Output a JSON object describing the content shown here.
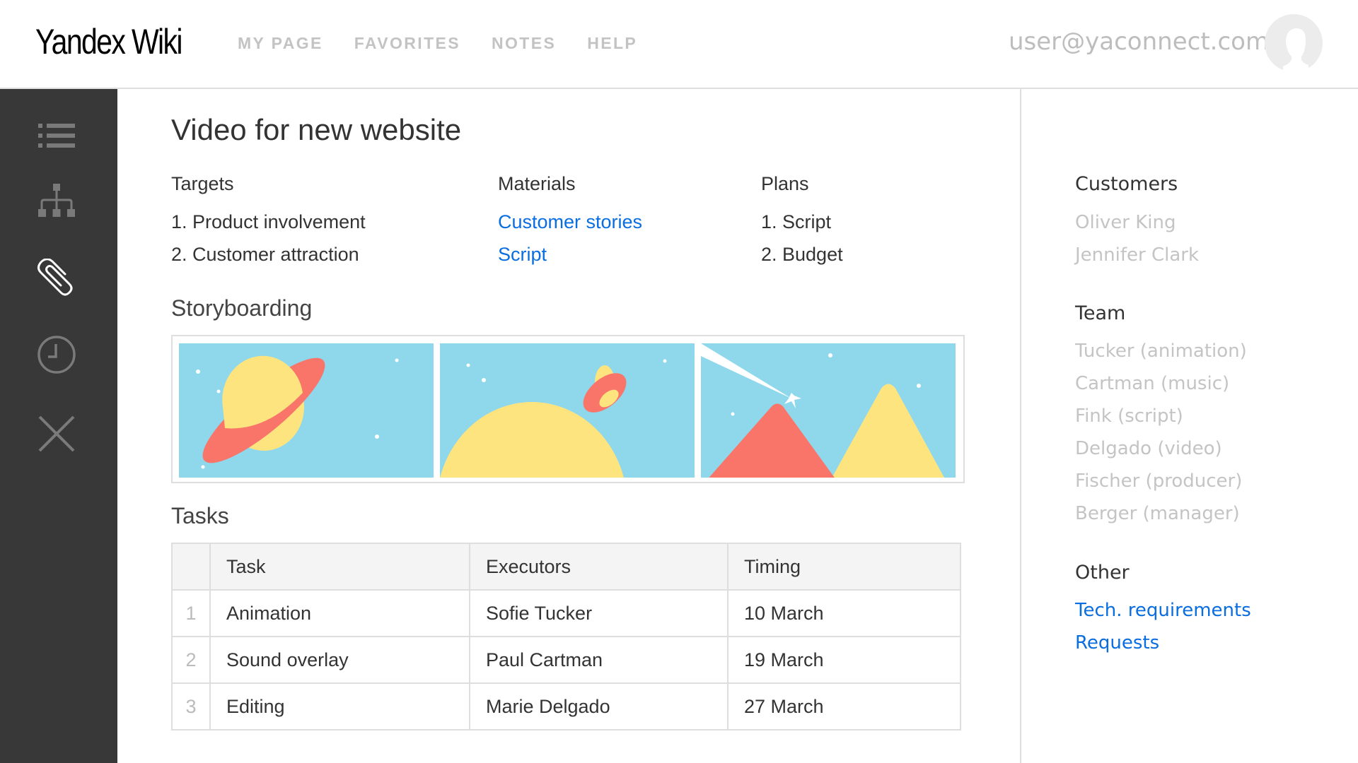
{
  "header": {
    "logo_brand": "Yandex",
    "logo_product": "Wiki",
    "nav": [
      "MY PAGE",
      "FAVORITES",
      "NOTES",
      "HELP"
    ],
    "user_email": "user@yaconnect.com"
  },
  "sidebar": {
    "items": [
      {
        "name": "list",
        "icon": "list-icon",
        "active": false
      },
      {
        "name": "tree",
        "icon": "sitemap-icon",
        "active": false
      },
      {
        "name": "attachments",
        "icon": "paperclip-icon",
        "active": true
      },
      {
        "name": "history",
        "icon": "clock-icon",
        "active": false
      },
      {
        "name": "close",
        "icon": "close-icon",
        "active": false
      }
    ]
  },
  "page": {
    "title": "Video for new website",
    "columns": [
      {
        "heading": "Targets",
        "items": [
          "1. Product involvement",
          "2. Customer attraction"
        ],
        "links": false
      },
      {
        "heading": "Materials",
        "items": [
          "Customer stories",
          "Script"
        ],
        "links": true
      },
      {
        "heading": "Plans",
        "items": [
          "1. Script",
          "2. Budget"
        ],
        "links": false
      }
    ],
    "storyboarding_heading": "Storyboarding",
    "storyboard_frames": [
      "planet-ringed",
      "ufo-over-planet",
      "comet-over-mountains"
    ],
    "tasks_heading": "Tasks",
    "tasks_table": {
      "headers": [
        "",
        "Task",
        "Executors",
        "Timing"
      ],
      "rows": [
        [
          "1",
          "Animation",
          "Sofie Tucker",
          "10 March"
        ],
        [
          "2",
          "Sound overlay",
          "Paul Cartman",
          "19 March"
        ],
        [
          "3",
          "Editing",
          "Marie Delgado",
          "27 March"
        ]
      ]
    }
  },
  "right_panel": {
    "customers_heading": "Customers",
    "customers": [
      "Oliver King",
      "Jennifer Clark"
    ],
    "team_heading": "Team",
    "team": [
      "Tucker (animation)",
      "Cartman (music)",
      "Fink (script)",
      "Delgado (video)",
      "Fischer (producer)",
      "Berger (manager)"
    ],
    "other_heading": "Other",
    "other_links": [
      "Tech. requirements",
      "Requests"
    ]
  },
  "colors": {
    "sidebar_bg": "#383838",
    "link": "#0a6de0",
    "sky": "#8fd8ec",
    "sun_yellow": "#fde47f",
    "coral": "#f9756a"
  }
}
